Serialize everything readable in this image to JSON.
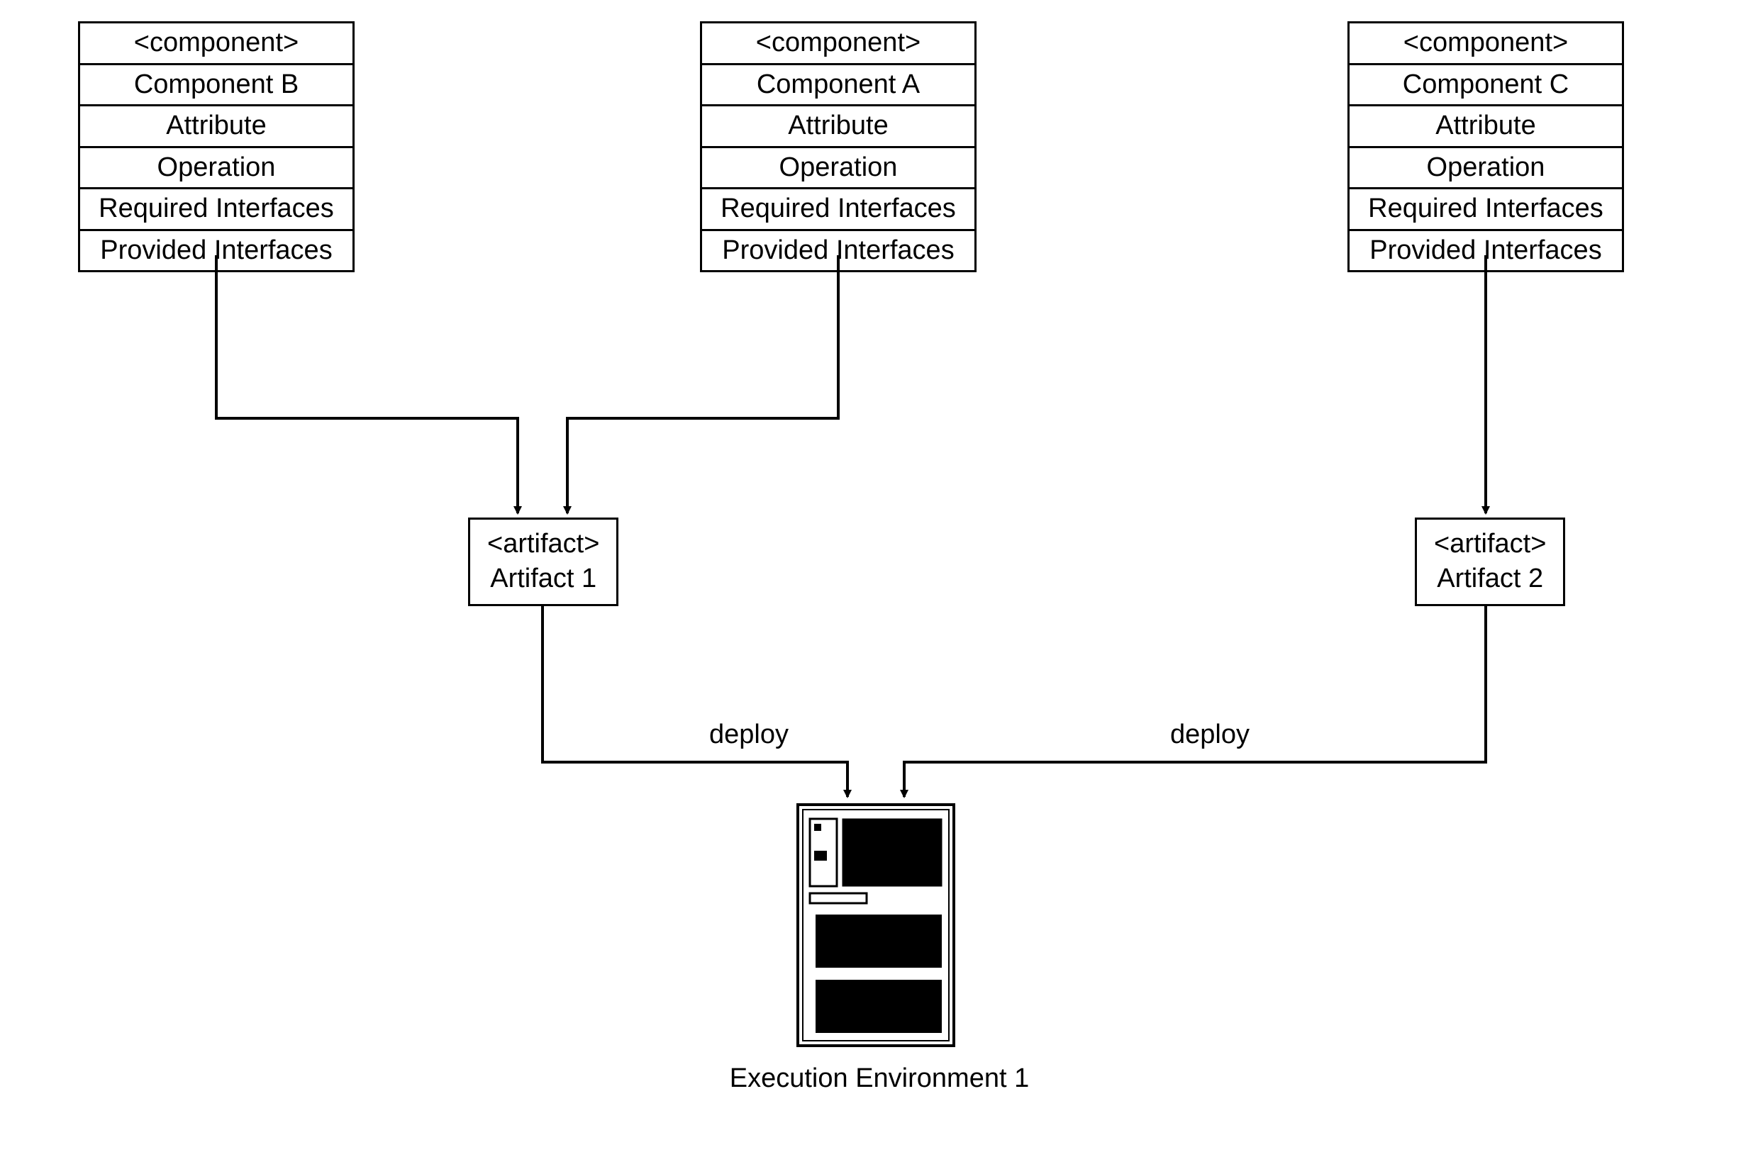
{
  "components": [
    {
      "id": "B",
      "stereotype": "<component>",
      "name": "Component B",
      "rows": [
        "Attribute",
        "Operation",
        "Required Interfaces",
        "Provided Interfaces"
      ]
    },
    {
      "id": "A",
      "stereotype": "<component>",
      "name": "Component A",
      "rows": [
        "Attribute",
        "Operation",
        "Required Interfaces",
        "Provided Interfaces"
      ]
    },
    {
      "id": "C",
      "stereotype": "<component>",
      "name": "Component C",
      "rows": [
        "Attribute",
        "Operation",
        "Required Interfaces",
        "Provided Interfaces"
      ]
    }
  ],
  "artifacts": [
    {
      "id": "1",
      "stereotype": "<artifact>",
      "name": "Artifact 1"
    },
    {
      "id": "2",
      "stereotype": "<artifact>",
      "name": "Artifact 2"
    }
  ],
  "deploy_label_1": "deploy",
  "deploy_label_2": "deploy",
  "execution_env_label": "Execution Environment 1"
}
